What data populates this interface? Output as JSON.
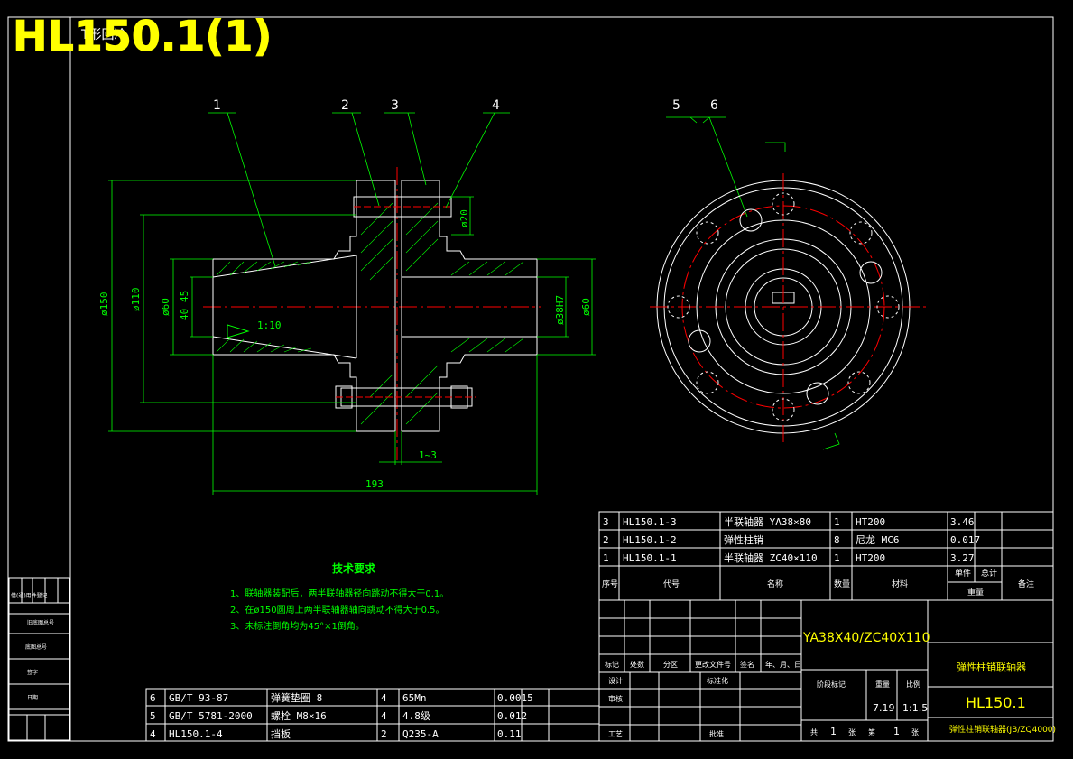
{
  "colors": {
    "background": "#000000",
    "frame": "#ffffff",
    "part": "#ffffff",
    "dimension": "#00ff00",
    "center_line": "#ff0000",
    "title": "#ffff00"
  },
  "title": {
    "main": "HL150.1(1)",
    "overlay": "T形回冷"
  },
  "balloons": [
    "1",
    "2",
    "3",
    "4",
    "5",
    "6"
  ],
  "dimensions": {
    "d150": "ø150",
    "d110": "ø110",
    "d60_left": "ø60",
    "d40": "40",
    "d45": "45",
    "d20": "ø20",
    "d38h7": "ø38H7",
    "d60_right": "ø60",
    "taper": "1:10",
    "gap": "1~3",
    "length": "193"
  },
  "tech_requirements": {
    "title": "技术要求",
    "items": [
      "1、联轴器装配后，两半联轴器径向跳动不得大于0.1。",
      "2、在ø150圆周上两半联轴器轴向跳动不得大于0.5。",
      "3、未标注倒角均为45°×1倒角。"
    ]
  },
  "left_strip": {
    "rows": [
      "借(通)用件登记",
      "旧底图总号",
      "底图总号",
      "签字",
      "日期"
    ]
  },
  "bom_upper": [
    {
      "no": "3",
      "code": "HL150.1-3",
      "name": "半联轴器 YA38×80",
      "qty": "1",
      "material": "HT200",
      "weight": "3.46"
    },
    {
      "no": "2",
      "code": "HL150.1-2",
      "name": "弹性柱销",
      "qty": "8",
      "material": "尼龙 MC6",
      "weight": "0.017"
    },
    {
      "no": "1",
      "code": "HL150.1-1",
      "name": "半联轴器 ZC40×110",
      "qty": "1",
      "material": "HT200",
      "weight": "3.27"
    }
  ],
  "bom_header": {
    "no": "序号",
    "code": "代号",
    "name": "名称",
    "qty": "数量",
    "material": "材料",
    "unit": "单件",
    "total": "总计",
    "weight": "重量",
    "remark": "备注"
  },
  "bom_lower": [
    {
      "no": "6",
      "code": "GB/T 93-87",
      "name": "弹簧垫圈 8",
      "qty": "4",
      "material": "65Mn",
      "weight": "0.0015"
    },
    {
      "no": "5",
      "code": "GB/T 5781-2000",
      "name": "螺栓 M8×16",
      "qty": "4",
      "material": "4.8级",
      "weight": "0.012"
    },
    {
      "no": "4",
      "code": "HL150.1-4",
      "name": "挡板",
      "qty": "2",
      "material": "Q235-A",
      "weight": "0.11"
    }
  ],
  "title_block": {
    "spec": "YA38X40/ZC40X110",
    "product_name": "弹性柱销联轴器",
    "drawing_no": "HL150.1",
    "standard": "弹性柱销联轴器(JB/ZQ4000)",
    "mark_labels": [
      "标记",
      "处数",
      "分区",
      "更改文件号",
      "签名",
      "年、月、日"
    ],
    "design": "设计",
    "standardize": "标准化",
    "review": "审核",
    "process": "工艺",
    "approve": "批准",
    "stage_mark": "阶段标记",
    "weight_label": "重量",
    "scale_label": "比例",
    "weight": "7.19",
    "scale": "1:1.5",
    "sheet_total_label": "共",
    "sheet_label": "张",
    "sheet_no_label": "第",
    "sheets": "1",
    "sheet_no": "1"
  }
}
